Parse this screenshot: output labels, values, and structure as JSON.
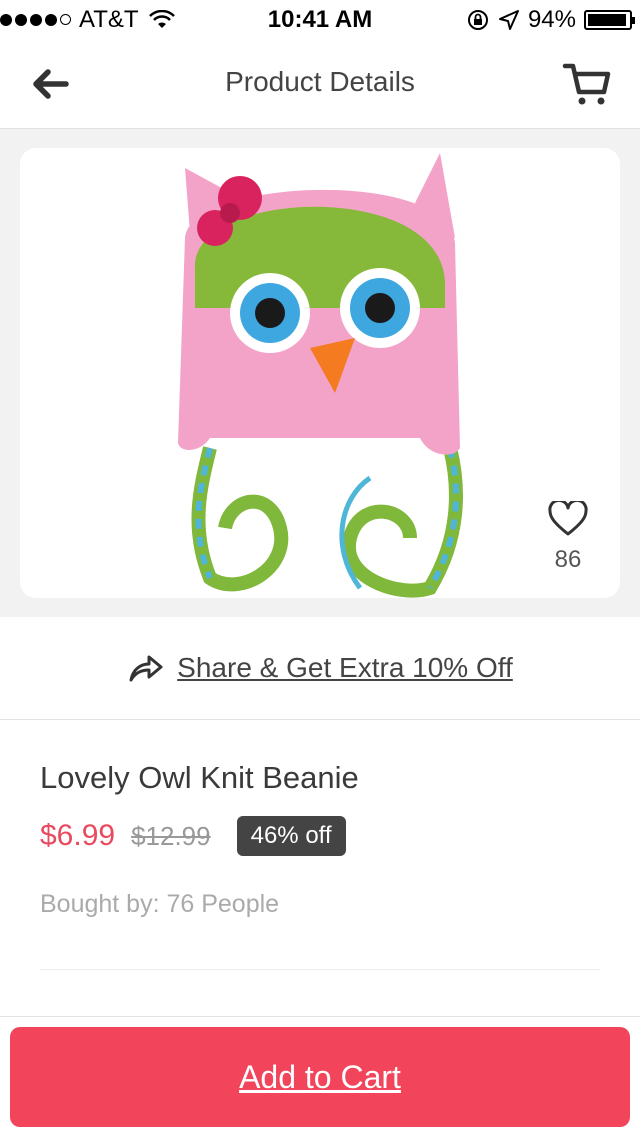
{
  "status_bar": {
    "carrier": "AT&T",
    "time": "10:41 AM",
    "battery_text": "94%",
    "battery_level": 0.94,
    "signal_bars_filled": 4,
    "signal_bars_total": 5
  },
  "nav": {
    "title": "Product Details",
    "back_icon": "arrow-left-icon",
    "cart_icon": "shopping-cart-icon"
  },
  "product": {
    "image_alt": "owl-knit-beanie",
    "like_count": "86",
    "name": "Lovely Owl Knit Beanie",
    "price": "$6.99",
    "original_price": "$12.99",
    "discount": "46% off",
    "bought_by": "Bought by: 76 People"
  },
  "share": {
    "label": "Share & Get Extra 10% Off"
  },
  "cta": {
    "add_to_cart": "Add to Cart"
  },
  "colors": {
    "accent": "#f2455b",
    "price": "#e84a5f",
    "badge_bg": "#444444"
  }
}
